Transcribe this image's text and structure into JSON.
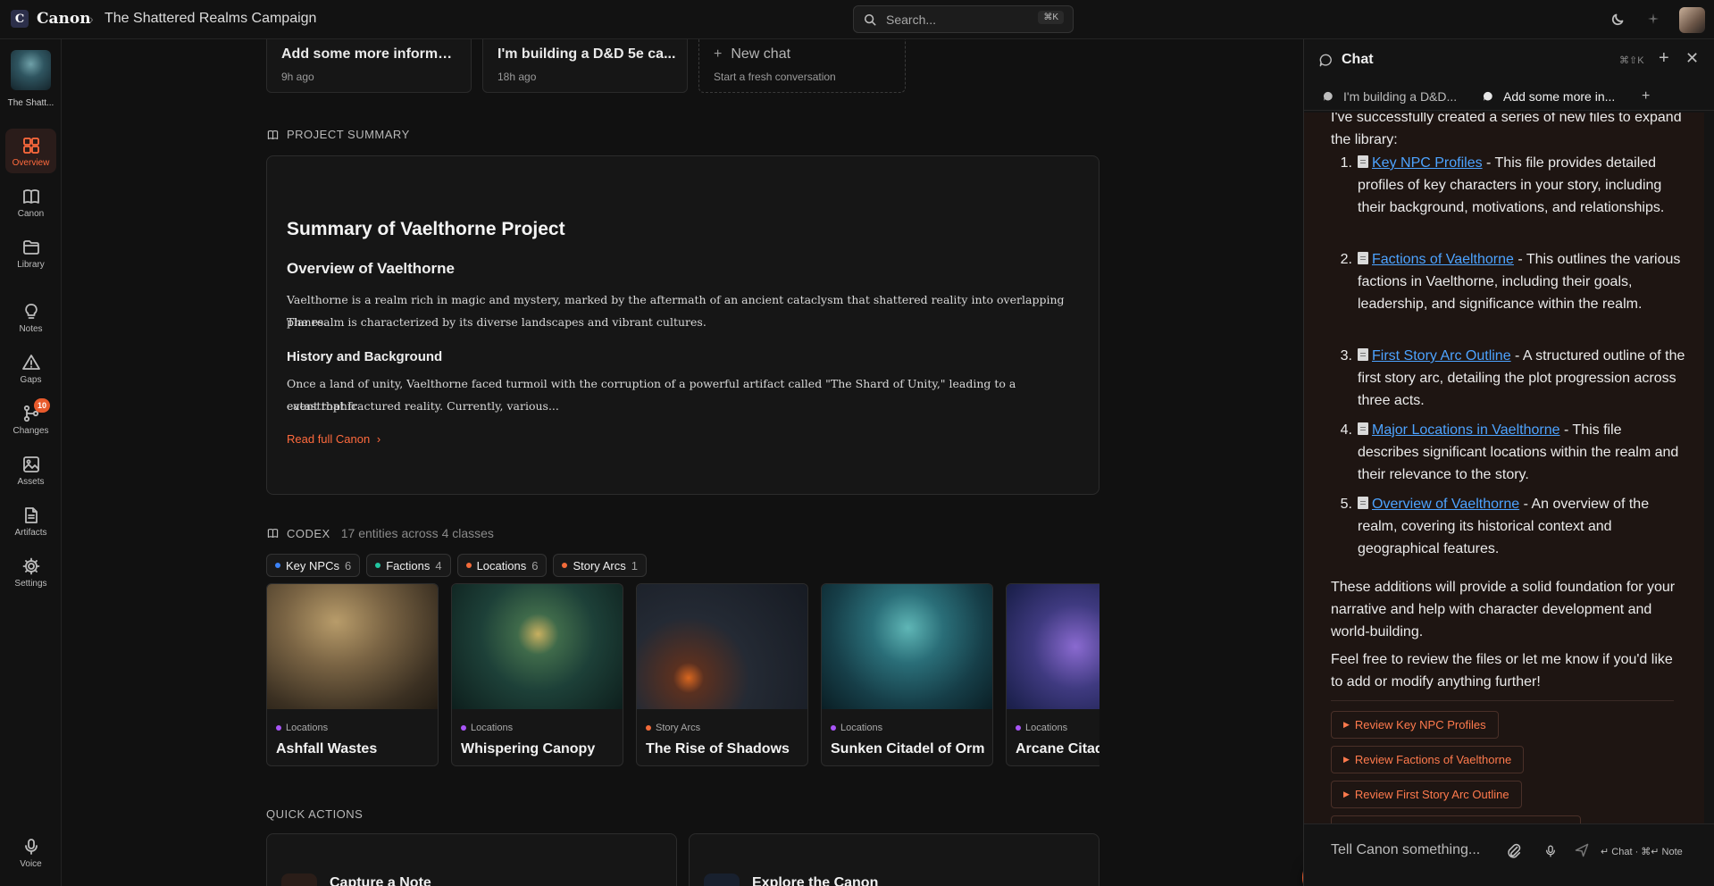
{
  "app": {
    "logo_letter": "C",
    "name": "Canon",
    "breadcrumb_title": "The Shattered Realms Campaign"
  },
  "search": {
    "placeholder": "Search...",
    "shortcut": "⌘K"
  },
  "sidebar": {
    "project_name": "The Shatt...",
    "items": [
      {
        "label": "Overview",
        "icon": "grid-icon",
        "active": true
      },
      {
        "label": "Canon",
        "icon": "book-icon"
      },
      {
        "label": "Library",
        "icon": "folder-icon"
      },
      {
        "label": "Notes",
        "icon": "lightbulb-icon"
      },
      {
        "label": "Gaps",
        "icon": "warning-icon"
      },
      {
        "label": "Changes",
        "icon": "branch-icon",
        "badge": "10"
      },
      {
        "label": "Assets",
        "icon": "image-icon"
      },
      {
        "label": "Artifacts",
        "icon": "document-icon"
      },
      {
        "label": "Settings",
        "icon": "gear-icon"
      }
    ],
    "voice_label": "Voice"
  },
  "recent_chats": [
    {
      "title": "Add some more informat...",
      "time": "9h ago"
    },
    {
      "title": "I'm building a D&D 5e ca...",
      "time": "18h ago"
    }
  ],
  "new_chat": {
    "title": "New chat",
    "subtitle": "Start a fresh conversation"
  },
  "summary": {
    "section_label": "PROJECT SUMMARY",
    "title": "Summary of Vaelthorne Project",
    "overview_heading": "Overview of Vaelthorne",
    "overview_line1": "Vaelthorne is a realm rich in magic and mystery, marked by the aftermath of an ancient cataclysm that shattered reality into overlapping planes.",
    "overview_line2": "The realm is characterized by its diverse landscapes and vibrant cultures.",
    "history_heading": "History and Background",
    "history_line1": "Once a land of unity, Vaelthorne faced turmoil with the corruption of a powerful artifact called \"The Shard of Unity,\" leading to a catastrophic",
    "history_line2": "event that fractured reality. Currently, various...",
    "read_link": "Read full Canon"
  },
  "codex": {
    "section_label": "CODEX",
    "count_text": "17 entities across 4 classes",
    "chips": [
      {
        "label": "Key NPCs",
        "count": "6",
        "color": "#3b82f6"
      },
      {
        "label": "Factions",
        "count": "4",
        "color": "#22c5a0"
      },
      {
        "label": "Locations",
        "count": "6",
        "color": "#f26b3a"
      },
      {
        "label": "Story Arcs",
        "count": "1",
        "color": "#f26b3a"
      }
    ],
    "entities": [
      {
        "category": "Locations",
        "name": "Ashfall Wastes",
        "dot": "#a855f7"
      },
      {
        "category": "Locations",
        "name": "Whispering Canopy",
        "dot": "#a855f7"
      },
      {
        "category": "Story Arcs",
        "name": "The Rise of Shadows",
        "dot": "#f26b3a"
      },
      {
        "category": "Locations",
        "name": "Sunken Citadel of Orm",
        "dot": "#a855f7"
      },
      {
        "category": "Locations",
        "name": "Arcane Citad",
        "dot": "#a855f7"
      }
    ]
  },
  "quick_actions": {
    "section_label": "QUICK ACTIONS",
    "items": [
      {
        "title": "Capture a Note"
      },
      {
        "title": "Explore the Canon"
      }
    ]
  },
  "fab": {
    "symbol": "+"
  },
  "chat": {
    "title": "Chat",
    "shortcut": "⌘⇧K",
    "tabs": [
      {
        "label": "I'm building a D&D..."
      },
      {
        "label": "Add some more in..."
      }
    ],
    "intro": "I've successfully created a series of new files to expand the library:",
    "list": [
      {
        "num": "1.",
        "link": "Key NPC Profiles",
        "text": " - This file provides detailed profiles of key characters in your story, including their background, motivations, and relationships."
      },
      {
        "num": "2.",
        "link": "Factions of Vaelthorne",
        "text": " - This outlines the various factions in Vaelthorne, including their goals, leadership, and significance within the realm."
      },
      {
        "num": "3.",
        "link": "First Story Arc Outline",
        "text": " - A structured outline of the first story arc, detailing the plot progression across three acts."
      },
      {
        "num": "4.",
        "link": "Major Locations in Vaelthorne",
        "text": " - This file describes significant locations within the realm and their relevance to the story."
      },
      {
        "num": "5.",
        "link": "Overview of Vaelthorne",
        "text": " - An overview of the realm, covering its historical context and geographical features."
      }
    ],
    "para2": "These additions will provide a solid foundation for your narrative and help with character development and world-building.",
    "para3": "Feel free to review the files or let me know if you'd like to add or modify anything further!",
    "review_buttons": [
      "Review Key NPC Profiles",
      "Review Factions of Vaelthorne",
      "Review First Story Arc Outline"
    ],
    "input_placeholder": "Tell Canon something...",
    "hint": "↵ Chat · ⌘↵ Note"
  },
  "colors": {
    "accent": "#e85a2c",
    "link": "#4da3ff",
    "badge": "#e85a2c"
  }
}
